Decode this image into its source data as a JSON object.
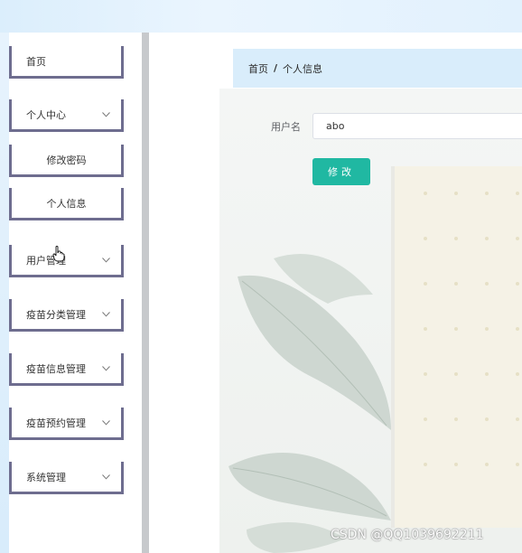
{
  "sidebar": {
    "items": [
      {
        "label": "首页"
      },
      {
        "label": "个人中心"
      },
      {
        "label": "修改密码"
      },
      {
        "label": "个人信息"
      },
      {
        "label": "用户管理"
      },
      {
        "label": "疫苗分类管理"
      },
      {
        "label": "疫苗信息管理"
      },
      {
        "label": "疫苗预约管理"
      },
      {
        "label": "系统管理"
      }
    ]
  },
  "breadcrumb": {
    "home": "首页",
    "separator": "/",
    "current": "个人信息"
  },
  "form": {
    "username_label": "用户名",
    "username_value": "abo",
    "submit_label": "修改"
  },
  "watermark": "CSDN @QQ1039692211",
  "colors": {
    "accent": "#20b8a2",
    "breadcrumb_bg": "#d9edfb",
    "menu_border": "#6e6d8f"
  }
}
